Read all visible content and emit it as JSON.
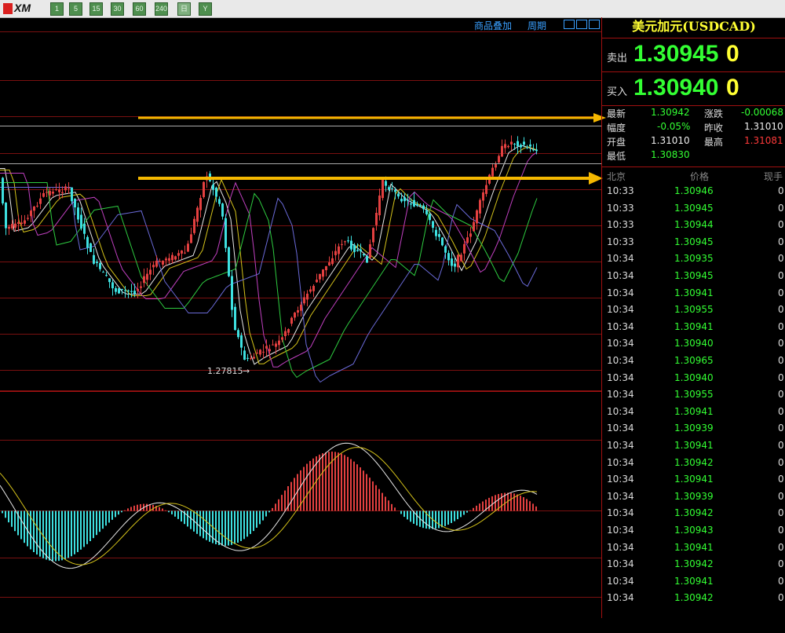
{
  "toolbar": {
    "logo": "XM",
    "buttons": [
      "1",
      "5",
      "15",
      "30",
      "60",
      "240",
      "日",
      "Y"
    ]
  },
  "chart_header": {
    "overlay_link": "商品叠加",
    "period_link": "周期"
  },
  "chart": {
    "low_label": "1.27815",
    "colors": {
      "up": "#e34040",
      "down": "#3ee0e0",
      "ma5": "#e8e8e8",
      "ma10": "#d4c21a",
      "ma20": "#c040c0",
      "ma60": "#2ecc40",
      "ma120": "#6a6ad8",
      "arrow": "#f5b800",
      "grid": "#7a1010"
    }
  },
  "sidebar": {
    "title": "美元加元(USDCAD)",
    "sell_label": "卖出",
    "sell_value": "1.30945",
    "sell_suffix": "0",
    "buy_label": "买入",
    "buy_value": "1.30940",
    "buy_suffix": "0",
    "stats": {
      "latest_label": "最新",
      "latest_value": "1.30942",
      "change_label": "涨跌",
      "change_value": "-0.00068",
      "amp_label": "幅度",
      "amp_value": "-0.05%",
      "prev_label": "昨收",
      "prev_value": "1.31010",
      "open_label": "开盘",
      "open_value": "1.31010",
      "high_label": "最高",
      "high_value": "1.31081",
      "low_label": "最低",
      "low_value": "1.30830"
    },
    "trades_header": {
      "time": "北京",
      "price": "价格",
      "volume": "现手"
    },
    "trades": [
      {
        "time": "10:33",
        "price": "1.30946",
        "vol": "0"
      },
      {
        "time": "10:33",
        "price": "1.30945",
        "vol": "0"
      },
      {
        "time": "10:33",
        "price": "1.30944",
        "vol": "0"
      },
      {
        "time": "10:33",
        "price": "1.30945",
        "vol": "0"
      },
      {
        "time": "10:34",
        "price": "1.30935",
        "vol": "0"
      },
      {
        "time": "10:34",
        "price": "1.30945",
        "vol": "0"
      },
      {
        "time": "10:34",
        "price": "1.30941",
        "vol": "0"
      },
      {
        "time": "10:34",
        "price": "1.30955",
        "vol": "0"
      },
      {
        "time": "10:34",
        "price": "1.30941",
        "vol": "0"
      },
      {
        "time": "10:34",
        "price": "1.30940",
        "vol": "0"
      },
      {
        "time": "10:34",
        "price": "1.30965",
        "vol": "0"
      },
      {
        "time": "10:34",
        "price": "1.30940",
        "vol": "0"
      },
      {
        "time": "10:34",
        "price": "1.30955",
        "vol": "0"
      },
      {
        "time": "10:34",
        "price": "1.30941",
        "vol": "0"
      },
      {
        "time": "10:34",
        "price": "1.30939",
        "vol": "0"
      },
      {
        "time": "10:34",
        "price": "1.30941",
        "vol": "0"
      },
      {
        "time": "10:34",
        "price": "1.30942",
        "vol": "0"
      },
      {
        "time": "10:34",
        "price": "1.30941",
        "vol": "0"
      },
      {
        "time": "10:34",
        "price": "1.30939",
        "vol": "0"
      },
      {
        "time": "10:34",
        "price": "1.30942",
        "vol": "0"
      },
      {
        "time": "10:34",
        "price": "1.30943",
        "vol": "0"
      },
      {
        "time": "10:34",
        "price": "1.30941",
        "vol": "0"
      },
      {
        "time": "10:34",
        "price": "1.30942",
        "vol": "0"
      },
      {
        "time": "10:34",
        "price": "1.30941",
        "vol": "0"
      },
      {
        "time": "10:34",
        "price": "1.30942",
        "vol": "0"
      }
    ]
  }
}
